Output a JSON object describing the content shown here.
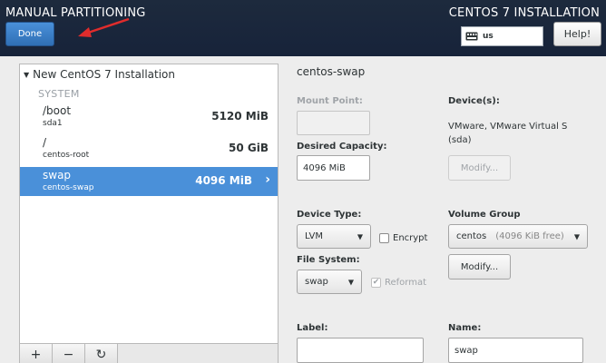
{
  "header": {
    "title": "MANUAL PARTITIONING",
    "product": "CENTOS 7 INSTALLATION",
    "done_label": "Done",
    "keyboard_layout": "us",
    "help_label": "Help!"
  },
  "partitions": {
    "heading": "New CentOS 7 Installation",
    "group_label": "SYSTEM",
    "items": [
      {
        "name": "/boot",
        "device": "sda1",
        "size": "5120 MiB"
      },
      {
        "name": "/",
        "device": "centos-root",
        "size": "50 GiB"
      },
      {
        "name": "swap",
        "device": "centos-swap",
        "size": "4096 MiB"
      }
    ],
    "toolbar": {
      "add": "+",
      "remove": "−",
      "refresh": "↻"
    }
  },
  "detail": {
    "title": "centos-swap",
    "mount_point_label": "Mount Point:",
    "mount_point_value": "",
    "desired_capacity_label": "Desired Capacity:",
    "desired_capacity_value": "4096 MiB",
    "devices_label": "Device(s):",
    "devices_value": "VMware, VMware Virtual S (sda)",
    "modify_label": "Modify...",
    "device_type_label": "Device Type:",
    "device_type_value": "LVM",
    "encrypt_label": "Encrypt",
    "volume_group_label": "Volume Group",
    "volume_group_name": "centos",
    "volume_group_free": "(4096 KiB free)",
    "file_system_label": "File System:",
    "file_system_value": "swap",
    "reformat_label": "Reformat",
    "label_label": "Label:",
    "label_value": "",
    "name_label": "Name:",
    "name_value": "swap"
  },
  "colors": {
    "header_bg": "#1d2a3d",
    "accent": "#4a90d9",
    "annotation_arrow": "#e02c2c"
  }
}
